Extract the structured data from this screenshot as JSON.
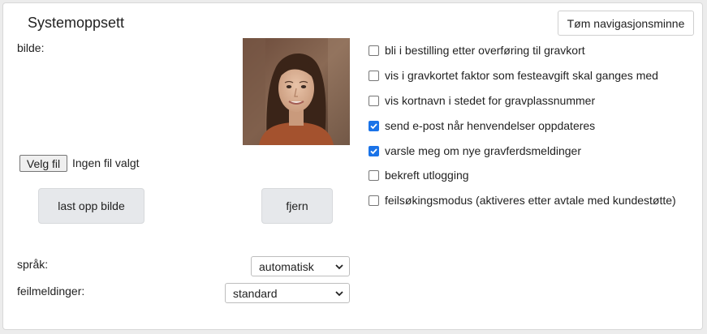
{
  "header": {
    "title": "Systemoppsett",
    "clear_nav_label": "Tøm navigasjonsminne"
  },
  "image_section": {
    "label": "bilde:",
    "file_button_label": "Velg fil",
    "file_status": "Ingen fil valgt",
    "upload_label": "last opp bilde",
    "remove_label": "fjern"
  },
  "settings": {
    "language": {
      "label": "språk:",
      "value": "automatisk"
    },
    "errors": {
      "label": "feilmeldinger:",
      "value": "standard"
    }
  },
  "options": [
    {
      "label": "bli i bestilling etter overføring til gravkort",
      "checked": false
    },
    {
      "label": "vis i gravkortet faktor som festeavgift skal ganges med",
      "checked": false
    },
    {
      "label": "vis kortnavn i stedet for gravplassnummer",
      "checked": false
    },
    {
      "label": "send e-post når henvendelser oppdateres",
      "checked": true
    },
    {
      "label": "varsle meg om nye gravferdsmeldinger",
      "checked": true
    },
    {
      "label": "bekreft utlogging",
      "checked": false
    },
    {
      "label": "feilsøkingsmodus (aktiveres etter avtale med kundestøtte)",
      "checked": false
    }
  ],
  "colors": {
    "checkbox_checked": "#1a73e8",
    "button_bg": "#e6e8eb"
  }
}
